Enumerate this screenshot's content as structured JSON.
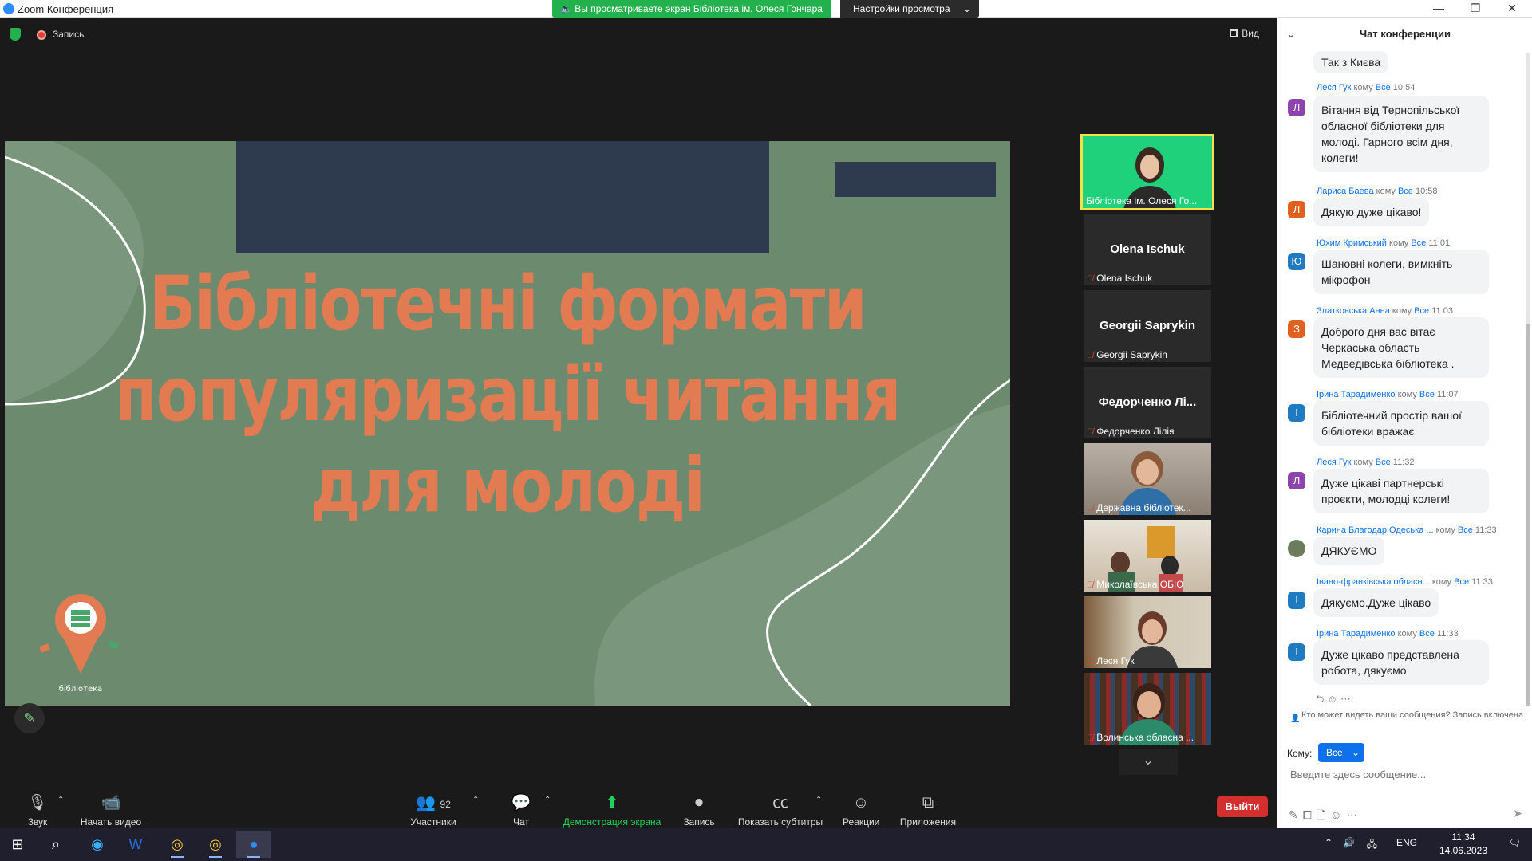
{
  "window": {
    "title": "Zoom Конференция",
    "share_banner": "Вы просматриваете экран Бібліотека ім. Олеся Гончара",
    "view_options": "Настройки просмотра",
    "controls": [
      "minimize-icon",
      "restore-icon",
      "close-icon"
    ]
  },
  "topbar": {
    "recording_label": "Запись",
    "view_label": "Вид"
  },
  "slide": {
    "title_lines": [
      "Бібліотечні формати",
      "популяризації читання",
      "для молоді"
    ],
    "logo_text": "бібліотека",
    "colors": {
      "background": "#6b8a6e",
      "title": "#e27a52",
      "redaction": "#2e3a4e"
    }
  },
  "gallery": {
    "tiles": [
      {
        "label": "Бібліотека ім. Олеся Го...",
        "big_name": "",
        "video": true,
        "active": true,
        "muted": false
      },
      {
        "label": "Olena Ischuk",
        "big_name": "Olena Ischuk",
        "video": false,
        "muted": true
      },
      {
        "label": "Georgii Saprykin",
        "big_name": "Georgii Saprykin",
        "video": false,
        "muted": true
      },
      {
        "label": "Федорченко Лілія",
        "big_name": "Федорченко Лі...",
        "video": false,
        "muted": true
      },
      {
        "label": "Державна бібліотек...",
        "big_name": "",
        "video": true,
        "muted": true
      },
      {
        "label": "Миколаївська ОБЮ",
        "big_name": "",
        "video": true,
        "muted": true
      },
      {
        "label": "Леся Гук",
        "big_name": "",
        "video": true,
        "muted": true
      },
      {
        "label": "Волинська обласна ...",
        "big_name": "",
        "video": true,
        "muted": true
      }
    ]
  },
  "toolbar": {
    "audio": "Звук",
    "video": "Начать видео",
    "participants": "Участники",
    "participants_count": "92",
    "chat": "Чат",
    "share": "Демонстрация экрана",
    "record": "Запись",
    "captions": "Показать субтитры",
    "reactions": "Реакции",
    "apps": "Приложения",
    "leave": "Выйти"
  },
  "chat": {
    "title": "Чат конференции",
    "top_fragment": "Так з Києва",
    "messages": [
      {
        "sender": "Леся Гук",
        "to": "Все",
        "time": "10:54",
        "initial": "Л",
        "color": "#8e44ad",
        "text": "Вітання від Тернопільської обласної бібліотеки для молоді. Гарного всім дня, колеги!"
      },
      {
        "sender": "Лариса Баева",
        "to": "Все",
        "time": "10:58",
        "initial": "Л",
        "color": "#e0601f",
        "text": "Дякую дуже цікаво!"
      },
      {
        "sender": "Юхим Кримський",
        "to": "Все",
        "time": "11:01",
        "initial": "Ю",
        "color": "#1f7ac0",
        "text": "Шановні колеги, вимкніть мікрофон"
      },
      {
        "sender": "Златковська Анна",
        "to": "Все",
        "time": "11:03",
        "initial": "З",
        "color": "#e0601f",
        "text": "Доброго дня вас вітає Черкаська область Медведівська бібліотека ."
      },
      {
        "sender": "Ірина Тарадименко",
        "to": "Все",
        "time": "11:07",
        "initial": "І",
        "color": "#1f7ac0",
        "text": "Бібліотечний простір вашої бібліотеки вражає"
      },
      {
        "sender": "Леся Гук",
        "to": "Все",
        "time": "11:32",
        "initial": "Л",
        "color": "#8e44ad",
        "text": "Дуже цікаві партнерські проєкти, молодці колеги!"
      },
      {
        "sender": "Карина Благодар,Одеська ...",
        "to": "Все",
        "time": "11:33",
        "initial": "",
        "color": "#6b7b5b",
        "text": "ДЯКУЄМО"
      },
      {
        "sender": "Івано-франківська обласн...",
        "to": "Все",
        "time": "11:33",
        "initial": "І",
        "color": "#1f7ac0",
        "text": "Дякуємо.Дуже цікаво"
      },
      {
        "sender": "Ірина Тарадименко",
        "to": "Все",
        "time": "11:33",
        "initial": "І",
        "color": "#1f7ac0",
        "text": "Дуже цікаво представлена робота, дякуємо"
      }
    ],
    "to_word": "кому",
    "who_can_see": "Кто может видеть ваши сообщения? Запись включена",
    "to_label": "Кому:",
    "to_value": "Все",
    "input_placeholder": "Введите здесь сообщение..."
  },
  "taskbar": {
    "language": "ENG",
    "time": "11:34",
    "date": "14.06.2023"
  }
}
